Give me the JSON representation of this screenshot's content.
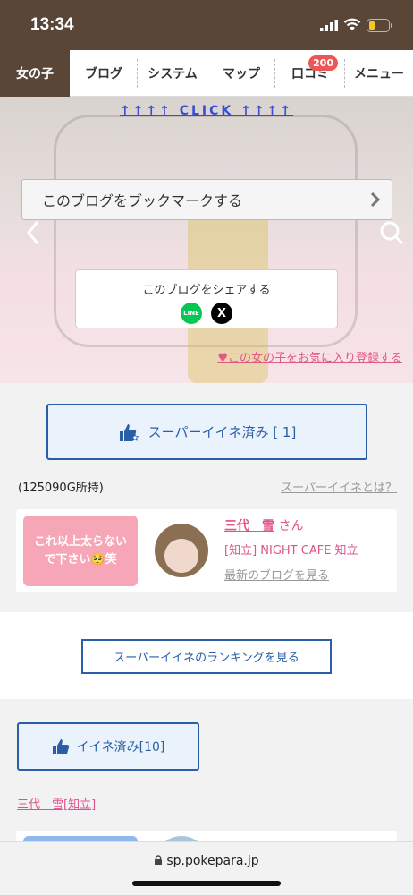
{
  "status": {
    "time": "13:34"
  },
  "nav": {
    "items": [
      {
        "label": "女の子"
      },
      {
        "label": "ブログ"
      },
      {
        "label": "システム"
      },
      {
        "label": "マップ"
      },
      {
        "label": "口コミ",
        "badge": "200"
      },
      {
        "label": "メニュー"
      }
    ]
  },
  "hero": {
    "click_link": "↑↑↑↑ CLICK ↑↑↑↑",
    "bookmark_label": "このブログをブックマークする",
    "share_label": "このブログをシェアする",
    "line_label": "LINE",
    "x_label": "X",
    "favorite_link": "♥この女の子をお気に入り登録する"
  },
  "superlike": {
    "label": "スーパーイイネ済み [ 1]",
    "gold_owned": "(125090G所持)",
    "what_link": "スーパーイイネとは？"
  },
  "profile": {
    "message": "これ以上太らない\nで下さい🥺笑",
    "name": "三代　雪",
    "honorific": "さん",
    "shop": "[知立] NIGHT CAFE 知立",
    "latest_blog_link": "最新のブログを見る"
  },
  "ranking": {
    "label": "スーパーイイネのランキングを見る"
  },
  "like": {
    "label": "イイネ済み[10]",
    "tag": "三代　雪[知立]"
  },
  "browser": {
    "url": "sp.pokepara.jp"
  }
}
